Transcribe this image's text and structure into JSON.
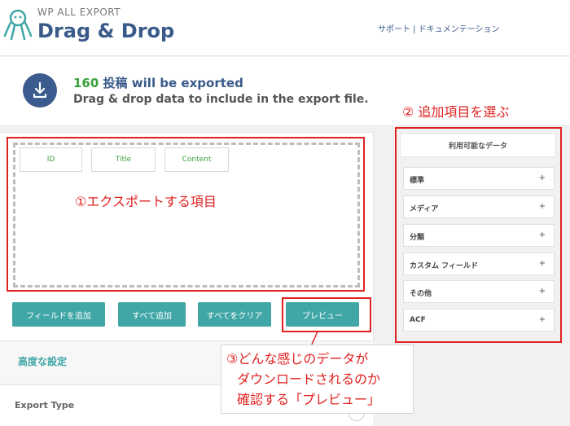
{
  "header": {
    "brand": "WP ALL EXPORT",
    "title": "Drag & Drop",
    "links": "サポート | ドキュメンテーション",
    "logo_icon": "octopus-logo-icon"
  },
  "summary": {
    "count": "160",
    "post_type": "投稿",
    "exported_text": "will be exported",
    "subtitle": "Drag & drop data to include in the export file.",
    "icon": "download-icon"
  },
  "fields": [
    {
      "label": "ID"
    },
    {
      "label": "Title"
    },
    {
      "label": "Content"
    }
  ],
  "annotations": {
    "export_items": "①エクスポートする項目",
    "choose_items": "② 追加項目を選ぶ",
    "preview_line1": "③どんな感じのデータが",
    "preview_line2": "ダウンロードされるのか",
    "preview_line3": "確認する「プレビュー」"
  },
  "buttons": {
    "add_field": "フィールドを追加",
    "add_all": "すべて追加",
    "clear_all": "すべてをクリア",
    "preview": "プレビュー"
  },
  "advanced": {
    "title": "高度な設定"
  },
  "export_type": {
    "label": "Export Type"
  },
  "available": {
    "title": "利用可能なデータ",
    "items": [
      {
        "label": "標準"
      },
      {
        "label": "メディア"
      },
      {
        "label": "分類"
      },
      {
        "label": "カスタム フィールド"
      },
      {
        "label": "その他"
      },
      {
        "label": "ACF"
      }
    ],
    "expand_symbol": "+"
  },
  "colors": {
    "accent_teal": "#40a6a6",
    "brand_blue": "#3a5b8a",
    "count_green": "#3aa13a",
    "annotation_red": "#e02020"
  }
}
